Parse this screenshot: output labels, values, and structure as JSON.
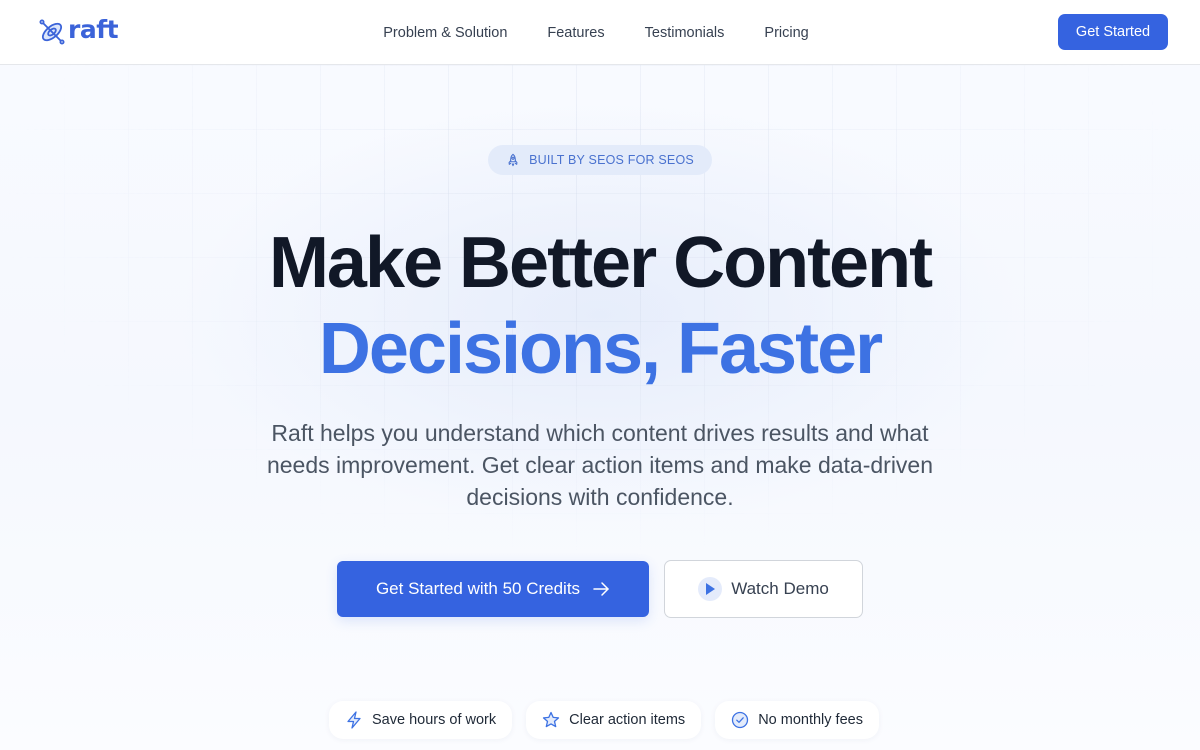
{
  "brand": {
    "name": "raft",
    "logo_icon": "kayak-icon",
    "accent_color": "#3563e0",
    "highlight_color": "#3d72e3"
  },
  "nav": {
    "links": [
      {
        "label": "Problem & Solution"
      },
      {
        "label": "Features"
      },
      {
        "label": "Testimonials"
      },
      {
        "label": "Pricing"
      }
    ],
    "cta_label": "Get Started"
  },
  "hero": {
    "badge": {
      "icon": "rocket-icon",
      "text": "BUILT BY SEOS FOR SEOS"
    },
    "headline_line1": "Make Better Content",
    "headline_line2": "Decisions, Faster",
    "subtext": "Raft helps you understand which content drives results and what needs improvement. Get clear action items and make data-driven decisions with confidence.",
    "primary_cta": {
      "label": "Get Started with 50 Credits",
      "icon": "arrow-right-icon"
    },
    "secondary_cta": {
      "label": "Watch Demo",
      "icon": "play-icon"
    }
  },
  "features": [
    {
      "icon": "lightning-icon",
      "label": "Save hours of work"
    },
    {
      "icon": "star-icon",
      "label": "Clear action items"
    },
    {
      "icon": "check-circle-icon",
      "label": "No monthly fees"
    }
  ]
}
